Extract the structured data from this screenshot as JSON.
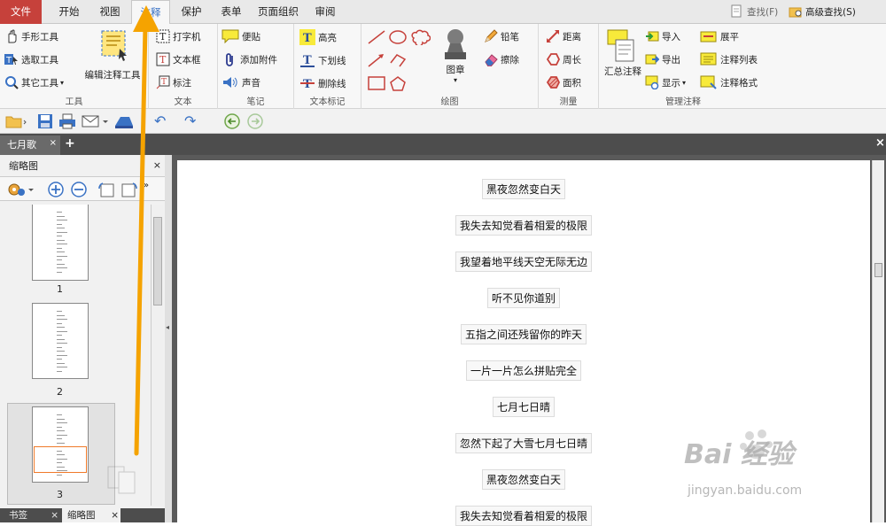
{
  "menu": {
    "tabs": [
      "文件",
      "开始",
      "视图",
      "注释",
      "保护",
      "表单",
      "页面组织",
      "审阅"
    ],
    "search": "查找(F)",
    "advanced_search": "高级查找(S)"
  },
  "ribbon": {
    "tools": {
      "label": "工具",
      "hand": "手形工具",
      "select": "选取工具",
      "other": "其它工具",
      "edit_annot": "编辑注释工具"
    },
    "text": {
      "label": "文本",
      "typewriter": "打字机",
      "textbox": "文本框",
      "callout": "标注"
    },
    "note": {
      "label": "笔记",
      "sticky": "便贴",
      "attach": "添加附件",
      "sound": "声音"
    },
    "textmark": {
      "label": "文本标记",
      "highlight": "高亮",
      "underline": "下划线",
      "strike": "删除线"
    },
    "drawing": {
      "label": "绘图",
      "stamp": "图章",
      "pencil": "铅笔",
      "eraser": "擦除"
    },
    "measure": {
      "label": "测量",
      "distance": "距离",
      "perimeter": "周长",
      "area": "面积"
    },
    "manage": {
      "label": "管理注释",
      "summary": "汇总注释",
      "import": "导入",
      "export": "导出",
      "show": "显示",
      "flatten": "展平",
      "list": "注释列表",
      "format": "注释格式"
    }
  },
  "doc_tab": "七月歌",
  "panel": {
    "title": "缩略图",
    "pages": [
      "1",
      "2",
      "3"
    ],
    "bottom_tabs": [
      "书签",
      "缩略图"
    ]
  },
  "document_lines": [
    "黑夜忽然变白天",
    "我失去知觉看着相爱的极限",
    "我望着地平线天空无际无边",
    "听不见你道别",
    "五指之间还残留你的昨天",
    "一片一片怎么拼贴完全",
    "七月七日晴",
    "忽然下起了大雪七月七日晴",
    "黑夜忽然变白天",
    "我失去知觉看着相爱的极限"
  ],
  "watermark": {
    "brand": "Bai 经验",
    "url": "jingyan.baidu.com"
  },
  "colors": {
    "file_tab": "#c6413b",
    "active_tab_text": "#3a72c4",
    "arrow": "#f5a300",
    "page_highlight": "#f07a2a"
  }
}
